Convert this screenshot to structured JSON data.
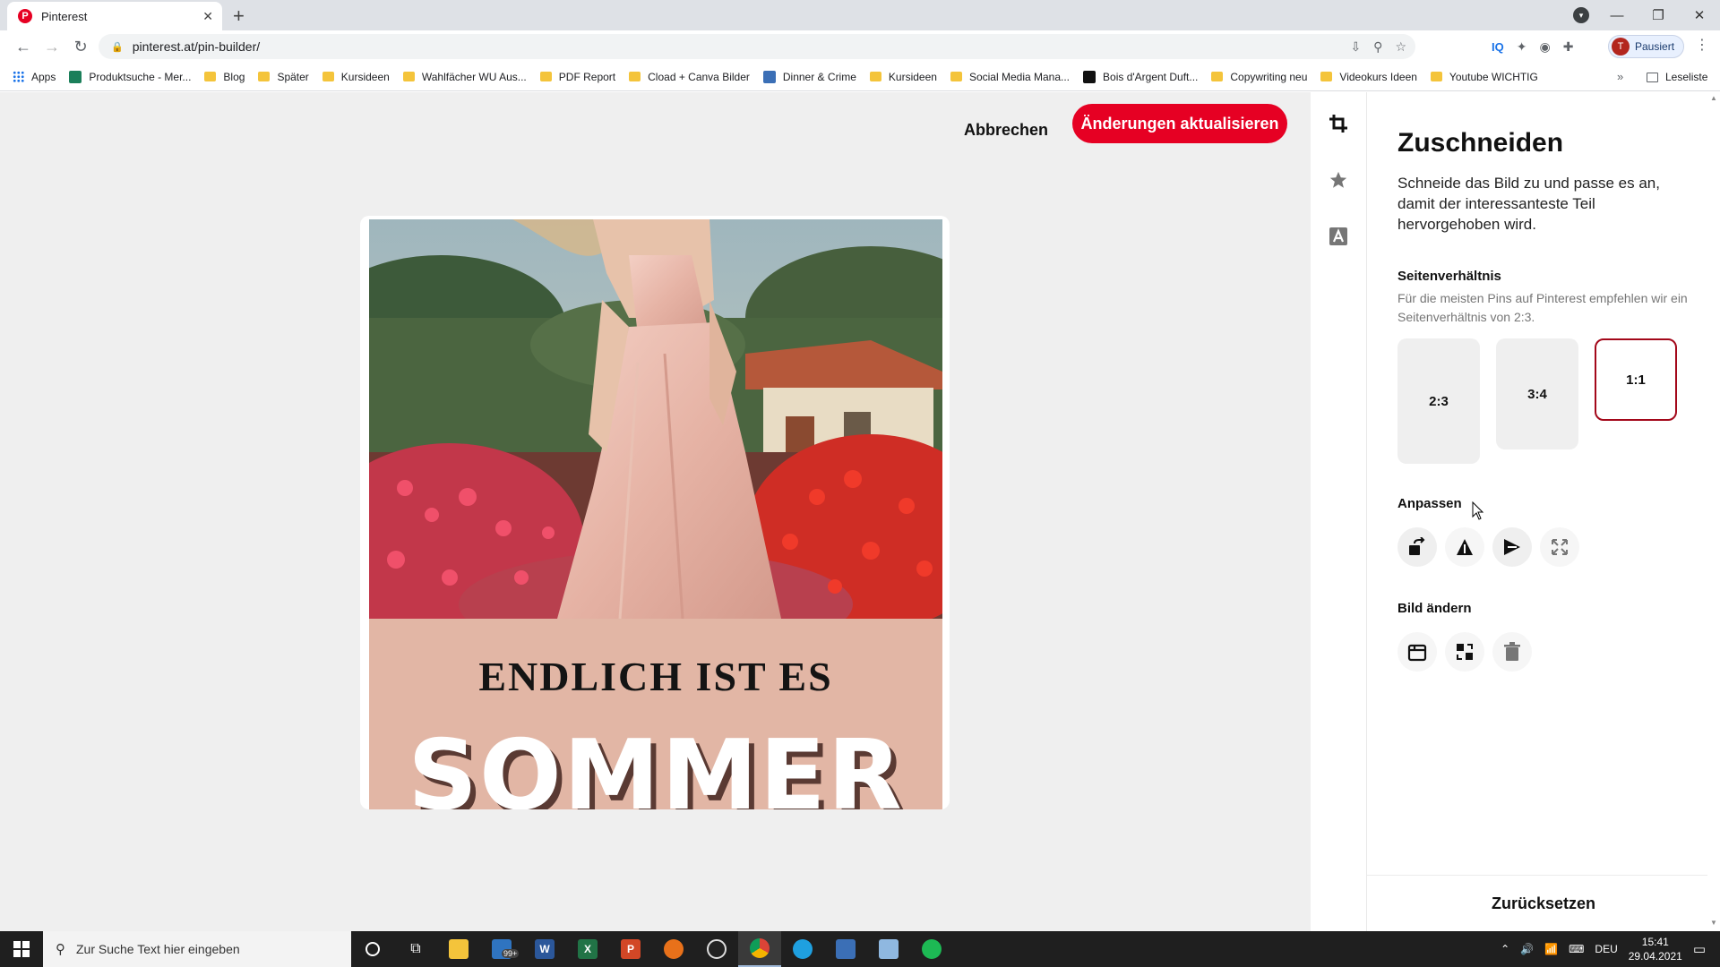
{
  "browser": {
    "tab_title": "Pinterest",
    "tab_favicon": "P",
    "url": "pinterest.at/pin-builder/",
    "profile_initial": "T",
    "profile_status": "Pausiert",
    "bookmarks": [
      {
        "label": "Apps",
        "type": "apps"
      },
      {
        "label": "Produktsuche - Mer...",
        "type": "site"
      },
      {
        "label": "Blog",
        "type": "folder"
      },
      {
        "label": "Später",
        "type": "folder"
      },
      {
        "label": "Kursideen",
        "type": "folder"
      },
      {
        "label": "Wahlfächer WU Aus...",
        "type": "folder"
      },
      {
        "label": "PDF Report",
        "type": "folder"
      },
      {
        "label": "Cload + Canva Bilder",
        "type": "folder"
      },
      {
        "label": "Dinner & Crime",
        "type": "site"
      },
      {
        "label": "Kursideen",
        "type": "folder"
      },
      {
        "label": "Social Media Mana...",
        "type": "folder"
      },
      {
        "label": "Bois d'Argent Duft...",
        "type": "site"
      },
      {
        "label": "Copywriting neu",
        "type": "folder"
      },
      {
        "label": "Videokurs Ideen",
        "type": "folder"
      },
      {
        "label": "Youtube WICHTIG",
        "type": "folder"
      }
    ],
    "reading_list": "Leseliste"
  },
  "editor": {
    "cancel_label": "Abbrechen",
    "update_label": "Änderungen aktualisieren",
    "pin_subtitle": "ENDLICH IST ES",
    "pin_title": "SOMMER",
    "rail_icons": [
      "crop-icon",
      "star-icon",
      "text-icon"
    ]
  },
  "panel": {
    "title": "Zuschneiden",
    "description": "Schneide das Bild zu und passe es an, damit der interessanteste Teil hervorgehoben wird.",
    "ratio_section": "Seitenverhältnis",
    "ratio_desc": "Für die meisten Pins auf Pinterest empfehlen wir ein Seitenverhältnis von 2:3.",
    "ratios": [
      "2:3",
      "3:4",
      "1:1"
    ],
    "selected_ratio": "1:1",
    "adjust_section": "Anpassen",
    "adjust_icons": [
      "rotate-icon",
      "flip-vertical-icon",
      "flip-horizontal-icon",
      "expand-icon"
    ],
    "change_section": "Bild ändern",
    "change_icons": [
      "replace-image-icon",
      "swap-image-icon",
      "trash-icon"
    ],
    "reset_label": "Zurücksetzen"
  },
  "taskbar": {
    "search_placeholder": "Zur Suche Text hier eingeben",
    "mail_badge": "99+",
    "language": "DEU",
    "time": "15:41",
    "date": "29.04.2021"
  },
  "colors": {
    "brand_red": "#e60023",
    "selected_border": "#a3081a",
    "pin_text_bg": "#e2b6a5"
  }
}
